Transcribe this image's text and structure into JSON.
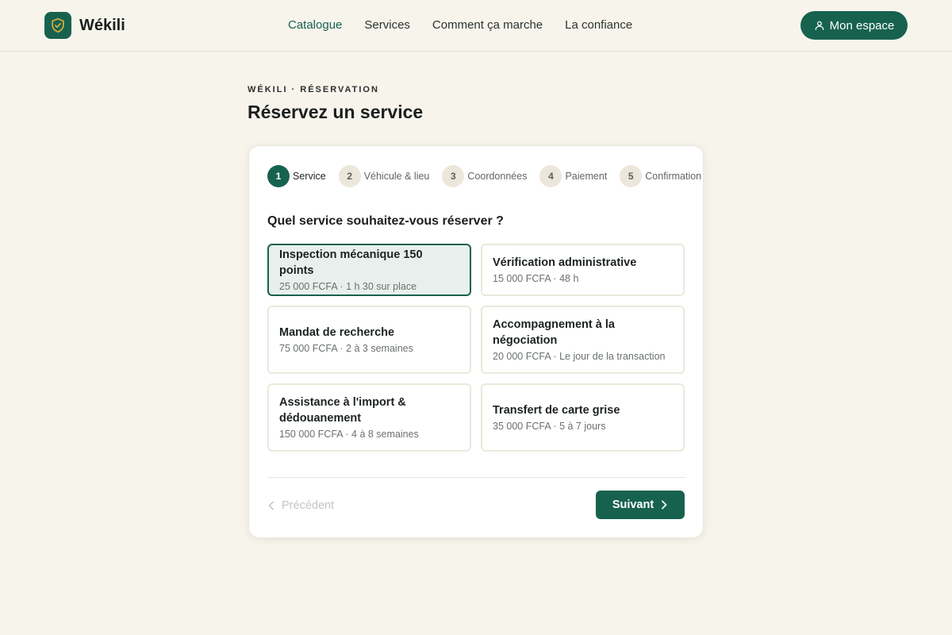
{
  "header": {
    "brand_name": "Wékili",
    "nav": [
      {
        "label": "Catalogue",
        "active": true
      },
      {
        "label": "Services",
        "active": false
      },
      {
        "label": "Comment ça marche",
        "active": false
      },
      {
        "label": "La confiance",
        "active": false
      }
    ],
    "account_label": "Mon espace"
  },
  "page": {
    "eyebrow": "WÉKILI · RÉSERVATION",
    "title": "Réservez un service"
  },
  "stepper": [
    {
      "num": "1",
      "label": "Service",
      "active": true
    },
    {
      "num": "2",
      "label": "Véhicule & lieu",
      "active": false
    },
    {
      "num": "3",
      "label": "Coordonnées",
      "active": false
    },
    {
      "num": "4",
      "label": "Paiement",
      "active": false
    },
    {
      "num": "5",
      "label": "Confirmation",
      "active": false
    }
  ],
  "question": "Quel service souhaitez-vous réserver ?",
  "services": [
    {
      "title": "Inspection mécanique 150 points",
      "meta": "25 000 FCFA · 1 h 30 sur place",
      "selected": true
    },
    {
      "title": "Vérification administrative",
      "meta": "15 000 FCFA · 48 h",
      "selected": false
    },
    {
      "title": "Mandat de recherche",
      "meta": "75 000 FCFA · 2 à 3 semaines",
      "selected": false
    },
    {
      "title": "Accompagnement à la négociation",
      "meta": "20 000 FCFA · Le jour de la transaction",
      "selected": false
    },
    {
      "title": "Assistance à l'import & dédouanement",
      "meta": "150 000 FCFA · 4 à 8 semaines",
      "selected": false
    },
    {
      "title": "Transfert de carte grise",
      "meta": "35 000 FCFA · 5 à 7 jours",
      "selected": false
    }
  ],
  "actions": {
    "prev_label": "Précédent",
    "next_label": "Suivant"
  },
  "colors": {
    "brand": "#17624f",
    "background": "#f7f4ec",
    "selected_bg": "#e8f0ed"
  },
  "icons": {
    "logo": "shield-check-icon",
    "account": "user-icon",
    "prev": "chevron-left-icon",
    "next": "chevron-right-icon"
  }
}
